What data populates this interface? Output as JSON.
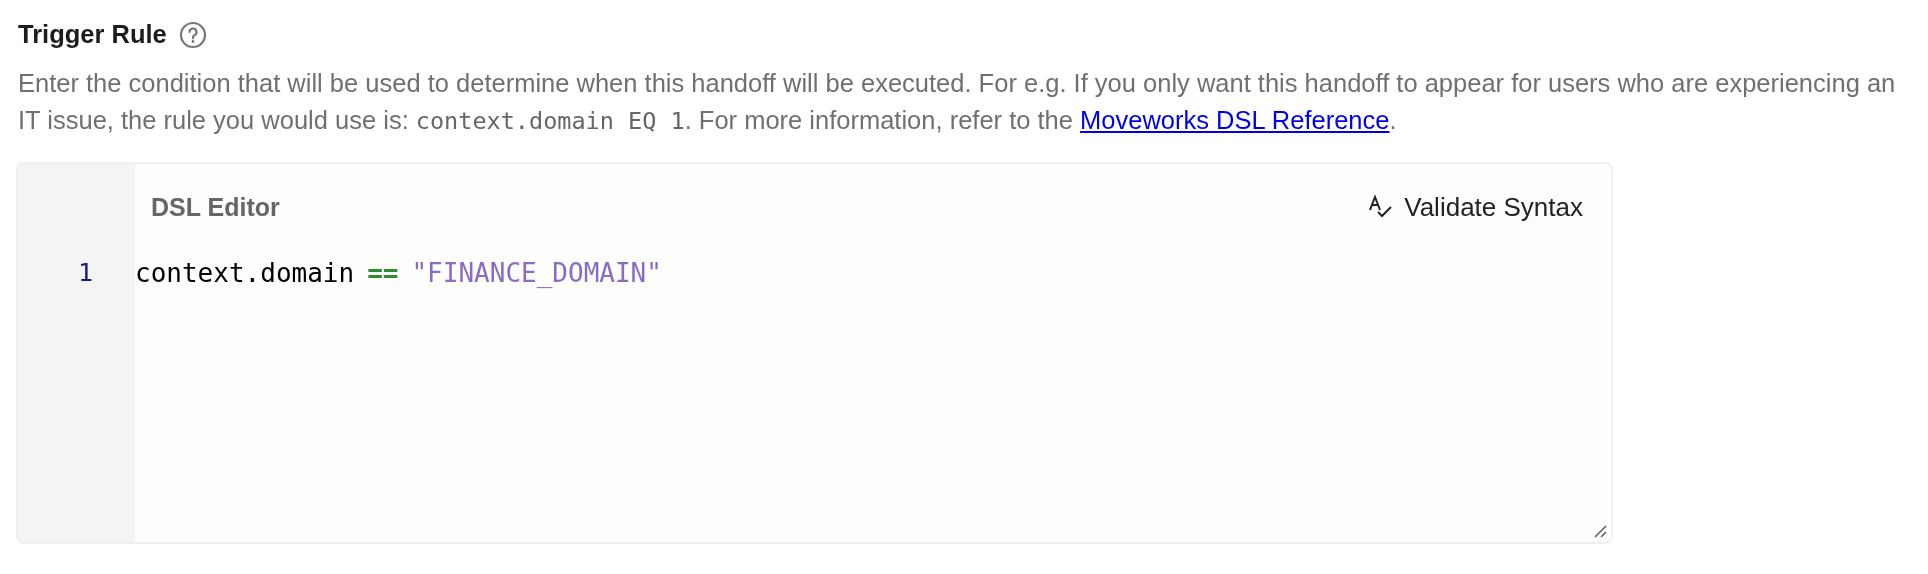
{
  "section": {
    "title": "Trigger Rule"
  },
  "description": [
    {
      "kind": "text",
      "text": "Enter the condition that will be used to determine when this handoff will be executed. For e.g. If you only want this handoff to appear for users who are experiencing an IT issue, the rule you would use is: "
    },
    {
      "kind": "code",
      "text": "context.domain EQ 1"
    },
    {
      "kind": "text",
      "text": ". For more information, refer to the "
    },
    {
      "kind": "link",
      "text": "Moveworks DSL Reference"
    },
    {
      "kind": "text",
      "text": "."
    }
  ],
  "editor": {
    "title": "DSL Editor",
    "validate_button": "Validate Syntax",
    "lines": [
      {
        "number": "1",
        "tokens": [
          {
            "kind": "plain",
            "text": "context.domain"
          },
          {
            "kind": "operator",
            "text": "=="
          },
          {
            "kind": "string",
            "text": "\"FINANCE_DOMAIN\""
          }
        ]
      }
    ]
  }
}
